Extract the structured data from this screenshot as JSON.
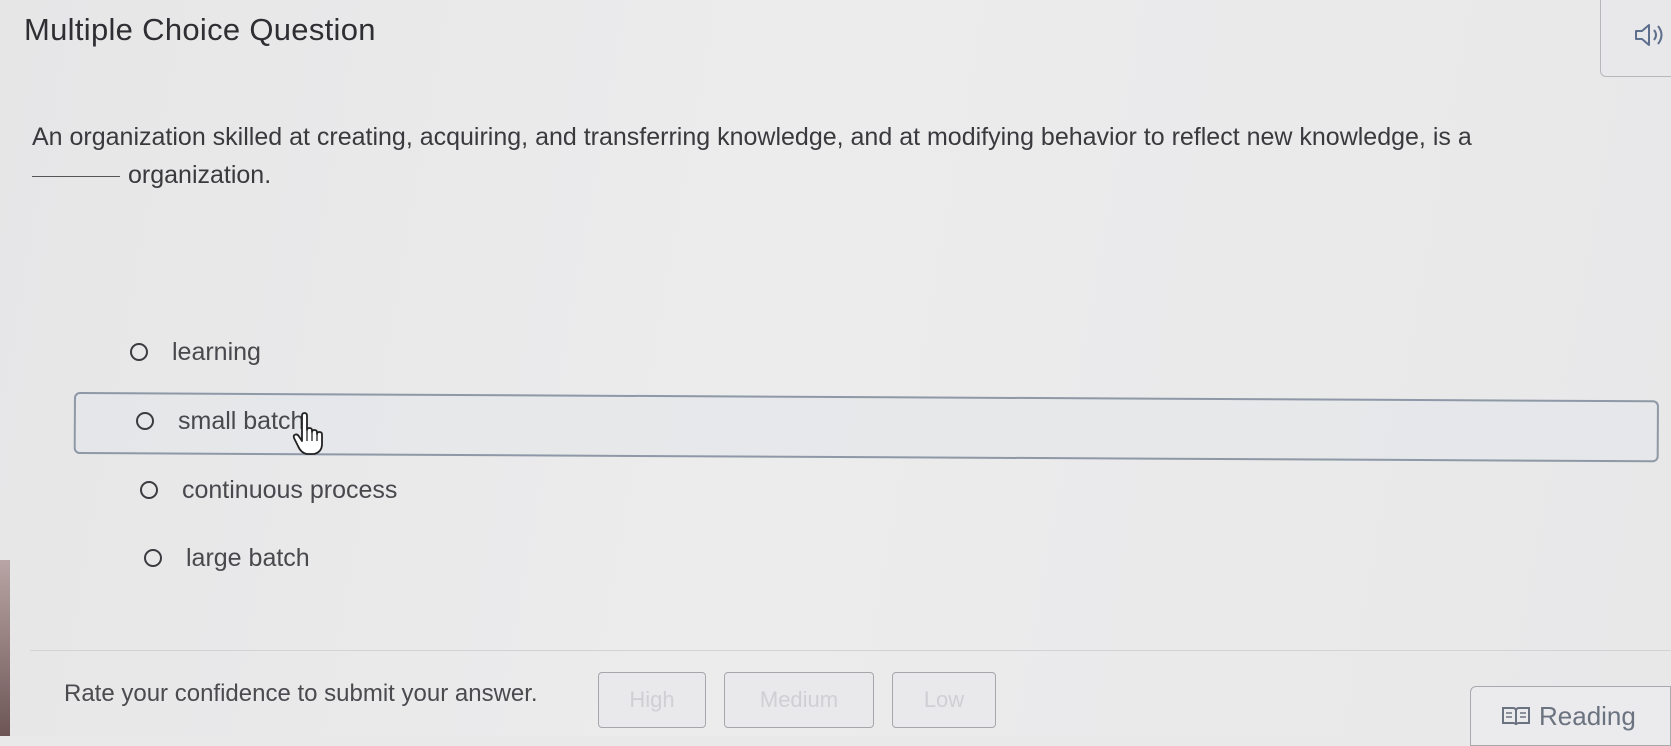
{
  "header": {
    "title": "Multiple Choice Question",
    "audio_icon": "speaker-icon"
  },
  "question": {
    "text": "An organization skilled at creating, acquiring, and transferring knowledge, and at modifying behavior to reflect new knowledge, is a",
    "text_after_blank": "organization."
  },
  "options": [
    {
      "label": "learning"
    },
    {
      "label": "small batch"
    },
    {
      "label": "continuous process"
    },
    {
      "label": "large batch"
    }
  ],
  "confidence": {
    "prompt": "Rate your confidence to submit your answer.",
    "high_label": "High",
    "medium_label": "Medium",
    "low_label": "Low"
  },
  "reading": {
    "label": "Reading",
    "icon": "book-icon"
  },
  "colors": {
    "background": "#e9e9ea",
    "text": "#333333",
    "highlight_border": "#8e98a6",
    "reading_text": "#6b7280"
  }
}
